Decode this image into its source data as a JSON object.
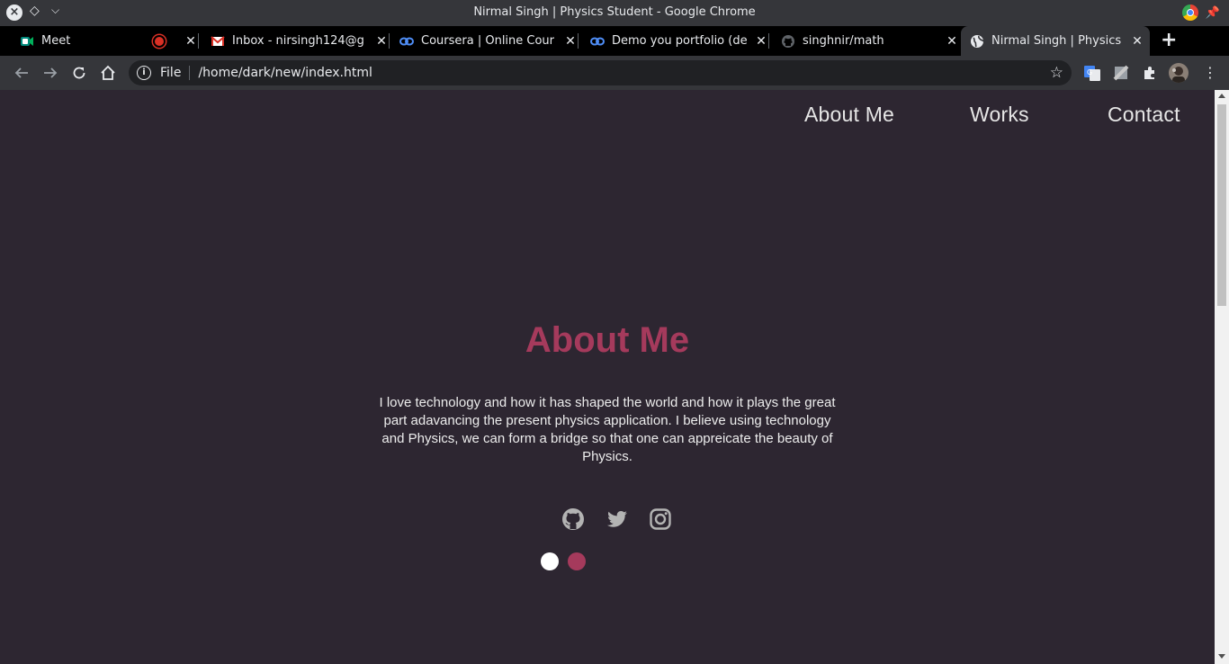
{
  "window": {
    "title": "Nirmal Singh | Physics Student - Google Chrome"
  },
  "tabs": [
    {
      "label": "Meet",
      "favicon": "meet-icon"
    },
    {
      "label": "Inbox - nirsingh124@g",
      "favicon": "gmail-icon"
    },
    {
      "label": "Coursera | Online Cour",
      "favicon": "coursera-icon"
    },
    {
      "label": "Demo you portfolio (de",
      "favicon": "coursera-icon"
    },
    {
      "label": "singhnir/math",
      "favicon": "github-icon"
    },
    {
      "label": "Nirmal Singh | Physics",
      "favicon": "globe-icon",
      "active": true
    }
  ],
  "omnibox": {
    "scheme_label": "File",
    "url": "/home/dark/new/index.html"
  },
  "page": {
    "nav": {
      "about": "About Me",
      "works": "Works",
      "contact": "Contact"
    },
    "heading": "About Me",
    "about_text": "I love technology and how it has shaped the world and how it plays the great part adavancing the present physics application. I believe using technology and Physics, we can form a bridge so that one can appreicate the beauty of Physics.",
    "social_icons": [
      "github-icon",
      "twitter-icon",
      "instagram-icon"
    ],
    "theme_dots": [
      {
        "name": "light-theme",
        "color": "#ffffff"
      },
      {
        "name": "accent-theme",
        "color": "#a53a5c"
      }
    ]
  },
  "colors": {
    "background": "#2d2631",
    "accent": "#a53a5c",
    "text": "#ececec"
  }
}
